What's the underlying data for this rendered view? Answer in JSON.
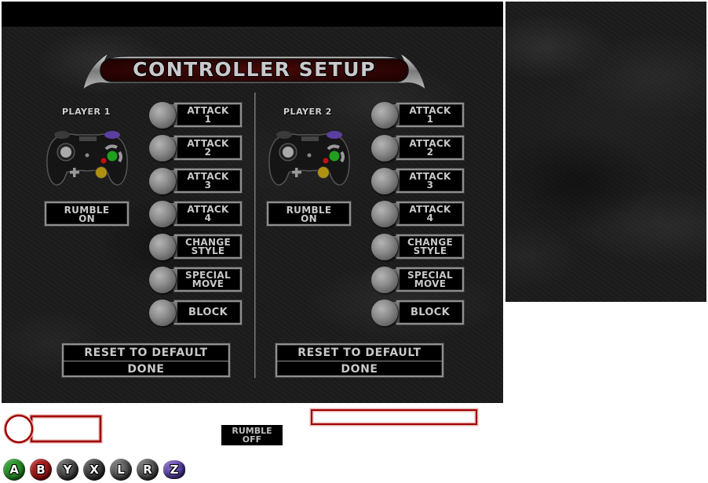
{
  "screen": {
    "title": "CONTROLLER SETUP"
  },
  "players": [
    {
      "label": "PLAYER 1",
      "rumble": [
        "RUMBLE",
        "ON"
      ],
      "bindings": [
        {
          "lines": [
            "ATTACK",
            "1"
          ]
        },
        {
          "lines": [
            "ATTACK",
            "2"
          ]
        },
        {
          "lines": [
            "ATTACK",
            "3"
          ]
        },
        {
          "lines": [
            "ATTACK",
            "4"
          ]
        },
        {
          "lines": [
            "CHANGE",
            "STYLE"
          ]
        },
        {
          "lines": [
            "SPECIAL",
            "MOVE"
          ]
        },
        {
          "lines": [
            "BLOCK"
          ]
        }
      ],
      "reset_label": "RESET TO DEFAULT",
      "done_label": "DONE"
    },
    {
      "label": "PLAYER 2",
      "rumble": [
        "RUMBLE",
        "ON"
      ],
      "bindings": [
        {
          "lines": [
            "ATTACK",
            "1"
          ]
        },
        {
          "lines": [
            "ATTACK",
            "2"
          ]
        },
        {
          "lines": [
            "ATTACK",
            "3"
          ]
        },
        {
          "lines": [
            "ATTACK",
            "4"
          ]
        },
        {
          "lines": [
            "CHANGE",
            "STYLE"
          ]
        },
        {
          "lines": [
            "SPECIAL",
            "MOVE"
          ]
        },
        {
          "lines": [
            "BLOCK"
          ]
        }
      ],
      "reset_label": "RESET TO DEFAULT",
      "done_label": "DONE"
    }
  ],
  "sprites": {
    "rumble_off": [
      "RUMBLE",
      "OFF"
    ],
    "highlight_color": "#a00000",
    "face_buttons": [
      {
        "label": "A",
        "color": "#1f7a1f",
        "icon": "a-button-icon"
      },
      {
        "label": "B",
        "color": "#8a1010",
        "icon": "b-button-icon"
      },
      {
        "label": "Y",
        "color": "#333333",
        "icon": "y-button-icon"
      },
      {
        "label": "X",
        "color": "#2a2a2a",
        "icon": "x-button-icon"
      },
      {
        "label": "L",
        "color": "#3c3c3c",
        "icon": "l-button-icon"
      },
      {
        "label": "R",
        "color": "#3a3a3a",
        "icon": "r-button-icon"
      },
      {
        "label": "Z",
        "color": "#4b3490",
        "icon": "z-button-icon"
      }
    ]
  },
  "colors": {
    "panel_text": "#c8c8c8",
    "title_banner_red": "#5a0a0a",
    "metal_border": "#8e8e8e"
  }
}
